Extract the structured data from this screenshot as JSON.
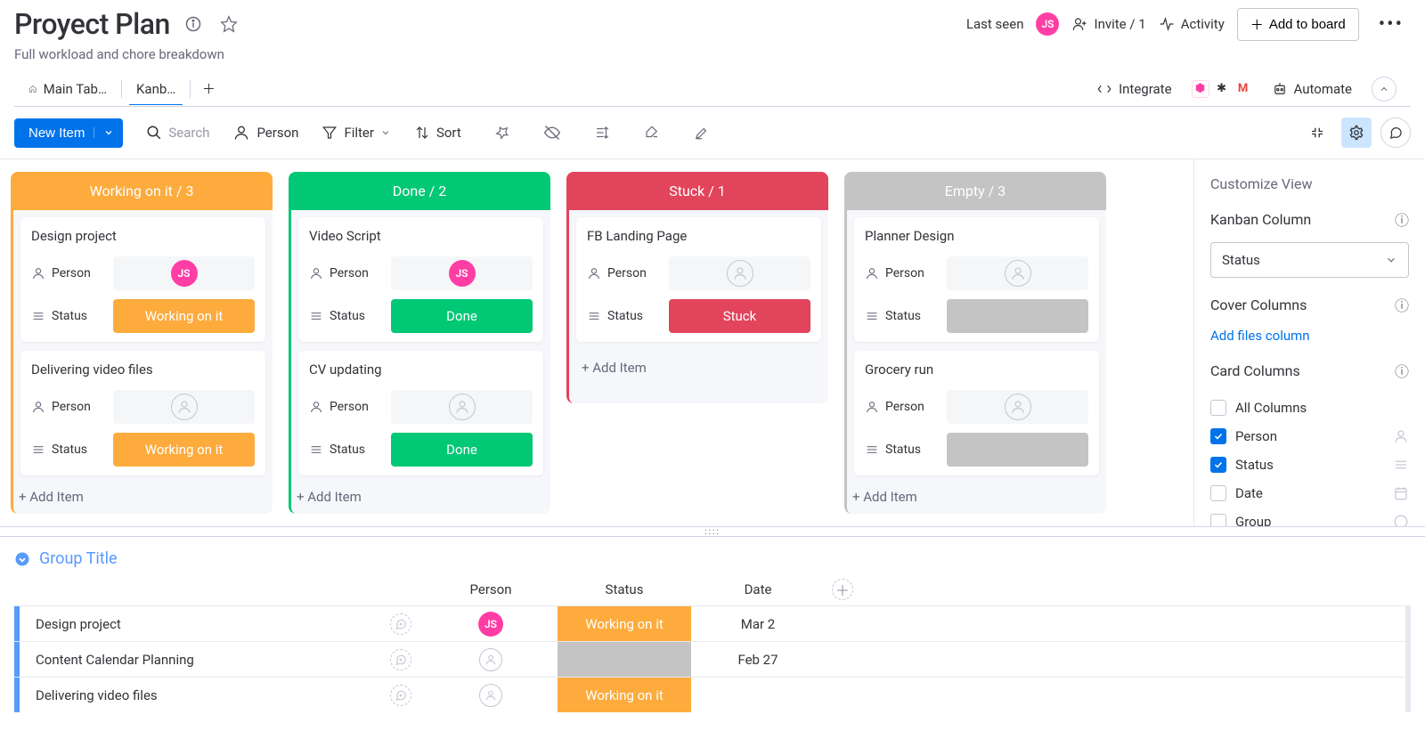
{
  "header": {
    "title": "Proyect Plan",
    "subtitle": "Full workload and chore breakdown",
    "last_seen": "Last seen",
    "avatar": "JS",
    "invite": "Invite / 1",
    "activity": "Activity",
    "add_to_board": "Add to board"
  },
  "tabs": {
    "items": [
      "Main Tab…",
      "Kanb…"
    ],
    "integrate": "Integrate",
    "automate": "Automate"
  },
  "toolbar": {
    "new_item": "New Item",
    "search": "Search",
    "person": "Person",
    "filter": "Filter",
    "sort": "Sort"
  },
  "columns": [
    {
      "title": "Working on it / 3",
      "color": "#fdab3d",
      "cards": [
        {
          "title": "Design project",
          "person": "JS",
          "status": "Working on it",
          "status_color": "#fdab3d"
        },
        {
          "title": "Delivering video files",
          "person": "",
          "status": "Working on it",
          "status_color": "#fdab3d"
        }
      ]
    },
    {
      "title": "Done / 2",
      "color": "#00c875",
      "cards": [
        {
          "title": "Video Script",
          "person": "JS",
          "status": "Done",
          "status_color": "#00c875"
        },
        {
          "title": "CV updating",
          "person": "",
          "status": "Done",
          "status_color": "#00c875"
        }
      ]
    },
    {
      "title": "Stuck / 1",
      "color": "#e2445c",
      "cards": [
        {
          "title": "FB Landing Page",
          "person": "",
          "status": "Stuck",
          "status_color": "#e2445c"
        }
      ]
    },
    {
      "title": "Empty / 3",
      "color": "#c4c4c4",
      "cards": [
        {
          "title": "Planner Design",
          "person": "",
          "status": "",
          "status_color": "#c4c4c4"
        },
        {
          "title": "Grocery run",
          "person": "",
          "status": "",
          "status_color": "#c4c4c4"
        }
      ]
    }
  ],
  "add_item": "+ Add Item",
  "field_person": "Person",
  "field_status": "Status",
  "side": {
    "title": "Customize View",
    "kanban_col": "Kanban Column",
    "kanban_val": "Status",
    "cover": "Cover Columns",
    "add_files": "Add files column",
    "card_cols": "Card Columns",
    "opts": [
      {
        "label": "All Columns",
        "on": false
      },
      {
        "label": "Person",
        "on": true
      },
      {
        "label": "Status",
        "on": true
      },
      {
        "label": "Date",
        "on": false
      },
      {
        "label": "Group",
        "on": false
      }
    ]
  },
  "table": {
    "group": "Group Title",
    "cols": {
      "person": "Person",
      "status": "Status",
      "date": "Date"
    },
    "rows": [
      {
        "name": "Design project",
        "person": "JS",
        "status": "Working on it",
        "status_color": "#fdab3d",
        "date": "Mar 2"
      },
      {
        "name": "Content Calendar Planning",
        "person": "",
        "status": "",
        "status_color": "#c4c4c4",
        "date": "Feb 27"
      },
      {
        "name": "Delivering video files",
        "person": "",
        "status": "Working on it",
        "status_color": "#fdab3d",
        "date": ""
      }
    ]
  }
}
